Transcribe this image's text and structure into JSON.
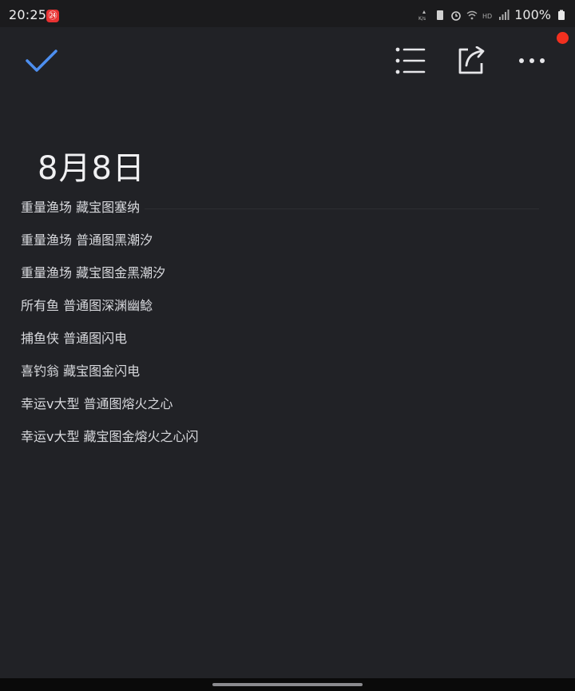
{
  "status_bar": {
    "time": "20:25",
    "app_badge": "㉔",
    "battery_percent": "100%",
    "icons": [
      "data-speed-icon",
      "sim-icon",
      "alarm-icon",
      "wifi-icon",
      "hd-icon",
      "signal-icon",
      "battery-icon"
    ]
  },
  "toolbar": {
    "confirm_icon": "checkmark-icon",
    "list_icon": "checklist-icon",
    "share_icon": "share-icon",
    "more_icon": "more-icon",
    "accent": "#4d8ff0",
    "notification_dot_color": "#f2301f"
  },
  "note": {
    "title": "8月8日",
    "lines": [
      "重量渔场 藏宝图塞纳",
      "重量渔场 普通图黑潮汐",
      "重量渔场 藏宝图金黑潮汐",
      "所有鱼 普通图深渊幽鲶",
      "捕鱼侠 普通图闪电",
      "喜钓翁 藏宝图金闪电",
      "幸运v大型 普通图熔火之心",
      "幸运v大型 藏宝图金熔火之心闪"
    ]
  },
  "theme": {
    "background": "#212226",
    "text": "#d8d9dd"
  }
}
